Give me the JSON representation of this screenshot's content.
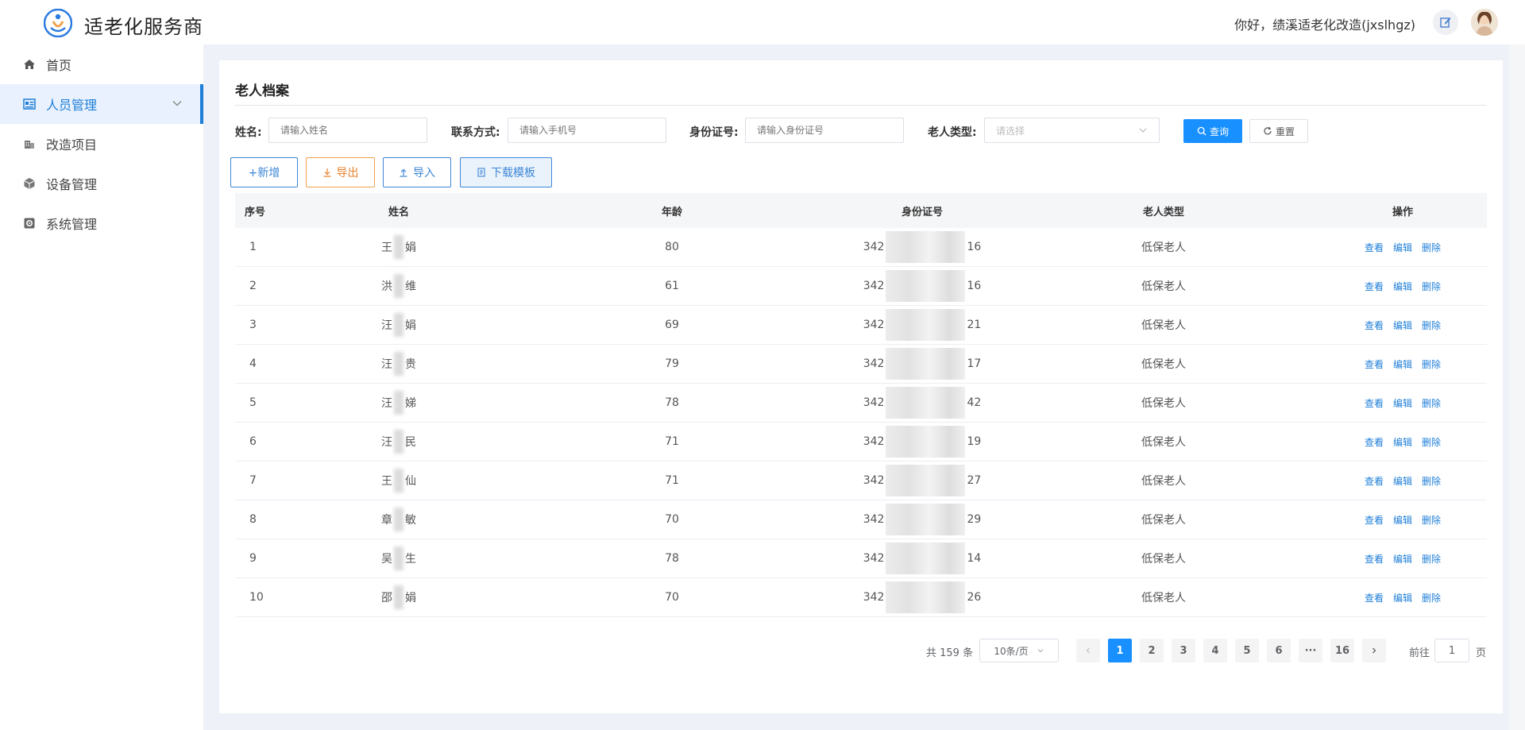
{
  "header": {
    "app_title": "适老化服务商",
    "greeting": "你好，绩溪适老化改造(jxslhgz)",
    "icons": {
      "logo": "logo-icon",
      "edit": "edit-icon",
      "avatar": "avatar"
    }
  },
  "sidebar": {
    "items": [
      {
        "label": "首页",
        "icon": "home-icon",
        "active": false
      },
      {
        "label": "人员管理",
        "icon": "people-icon",
        "active": true
      },
      {
        "label": "改造项目",
        "icon": "building-icon",
        "active": false
      },
      {
        "label": "设备管理",
        "icon": "device-icon",
        "active": false
      },
      {
        "label": "系统管理",
        "icon": "settings-icon",
        "active": false
      }
    ]
  },
  "page": {
    "title": "老人档案",
    "filters": {
      "name_label": "姓名:",
      "name_placeholder": "请输入姓名",
      "phone_label": "联系方式:",
      "phone_placeholder": "请输入手机号",
      "id_label": "身份证号:",
      "id_placeholder": "请输入身份证号",
      "type_label": "老人类型:",
      "type_placeholder": "请选择",
      "query_label": "查询",
      "reset_label": "重置"
    },
    "actions": {
      "add_label": "+新增",
      "export_label": "导出",
      "import_label": "导入",
      "template_label": "下载模板"
    },
    "table": {
      "columns": [
        "序号",
        "姓名",
        "年龄",
        "身份证号",
        "老人类型",
        "操作"
      ],
      "rows": [
        {
          "idx": "1",
          "name_a": "王",
          "name_b": "娟",
          "age": "80",
          "id_prefix": "342",
          "id_suffix": "16",
          "type": "低保老人"
        },
        {
          "idx": "2",
          "name_a": "洪",
          "name_b": "维",
          "age": "61",
          "id_prefix": "342",
          "id_suffix": "16",
          "type": "低保老人"
        },
        {
          "idx": "3",
          "name_a": "汪",
          "name_b": "娟",
          "age": "69",
          "id_prefix": "342",
          "id_suffix": "21",
          "type": "低保老人"
        },
        {
          "idx": "4",
          "name_a": "汪",
          "name_b": "贵",
          "age": "79",
          "id_prefix": "342",
          "id_suffix": "17",
          "type": "低保老人"
        },
        {
          "idx": "5",
          "name_a": "汪",
          "name_b": "娣",
          "age": "78",
          "id_prefix": "342",
          "id_suffix": "42",
          "type": "低保老人"
        },
        {
          "idx": "6",
          "name_a": "汪",
          "name_b": "民",
          "age": "71",
          "id_prefix": "342",
          "id_suffix": "19",
          "type": "低保老人"
        },
        {
          "idx": "7",
          "name_a": "王",
          "name_b": "仙",
          "age": "71",
          "id_prefix": "342",
          "id_suffix": "27",
          "type": "低保老人"
        },
        {
          "idx": "8",
          "name_a": "章",
          "name_b": "敏",
          "age": "70",
          "id_prefix": "342",
          "id_suffix": "29",
          "type": "低保老人"
        },
        {
          "idx": "9",
          "name_a": "吴",
          "name_b": "生",
          "age": "78",
          "id_prefix": "342",
          "id_suffix": "14",
          "type": "低保老人"
        },
        {
          "idx": "10",
          "name_a": "邵",
          "name_b": "娟",
          "age": "70",
          "id_prefix": "342",
          "id_suffix": "26",
          "type": "低保老人"
        }
      ],
      "row_actions": [
        "查看",
        "编辑",
        "删除"
      ]
    },
    "pagination": {
      "total_text": "共 159 条",
      "page_size": "10条/页",
      "pages": [
        "1",
        "2",
        "3",
        "4",
        "5",
        "6",
        "16"
      ],
      "ellipsis": "···",
      "current_page": "1",
      "goto_label": "前往",
      "goto_value": "1",
      "goto_unit": "页"
    }
  },
  "colors": {
    "accent": "#1890ff",
    "sidebar_active_bg": "#e8f1fd",
    "sidebar_active_text": "#1e7ed8",
    "export_orange": "#e8822d",
    "main_bg": "#eef1f7"
  }
}
